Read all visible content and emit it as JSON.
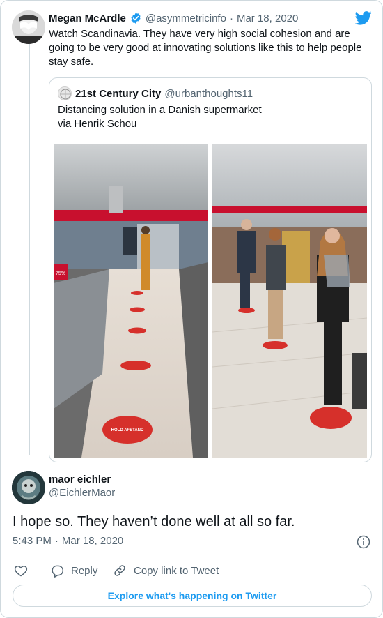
{
  "tweet": {
    "author_name": "Megan McArdle",
    "author_handle": "@asymmetricinfo",
    "date": "Mar 18, 2020",
    "separator": "·",
    "text": "Watch Scandinavia. They have very high social cohesion and are going to be very good at innovating solutions like this to help people stay safe.",
    "verified": true
  },
  "quote": {
    "author_name": "21st Century City",
    "author_handle": "@urbanthoughts11",
    "line1": "Distancing solution in a Danish supermarket",
    "line2": "via Henrik Schou",
    "floor_sign_text": "HOLD AFSTAND",
    "price_sign": "75%"
  },
  "reply": {
    "author_name": "maor eichler",
    "author_handle": "@EichlerMaor",
    "text": "I hope so. They haven’t done well at all so far.",
    "time": "5:43 PM",
    "date": "Mar 18, 2020",
    "separator": "·"
  },
  "actions": {
    "reply_label": "Reply",
    "copy_label": "Copy link to Tweet"
  },
  "footer": {
    "explore_label": "Explore what's happening on Twitter"
  },
  "colors": {
    "twitter_blue": "#1d9bf0",
    "verified_blue": "#1d9bf0",
    "border": "#cfd9de",
    "muted": "#536471"
  },
  "icons": {
    "logo": "twitter-bird-icon",
    "verified": "verified-badge-icon",
    "info": "info-icon",
    "like": "heart-icon",
    "reply": "speech-bubble-icon",
    "copy": "link-icon"
  }
}
